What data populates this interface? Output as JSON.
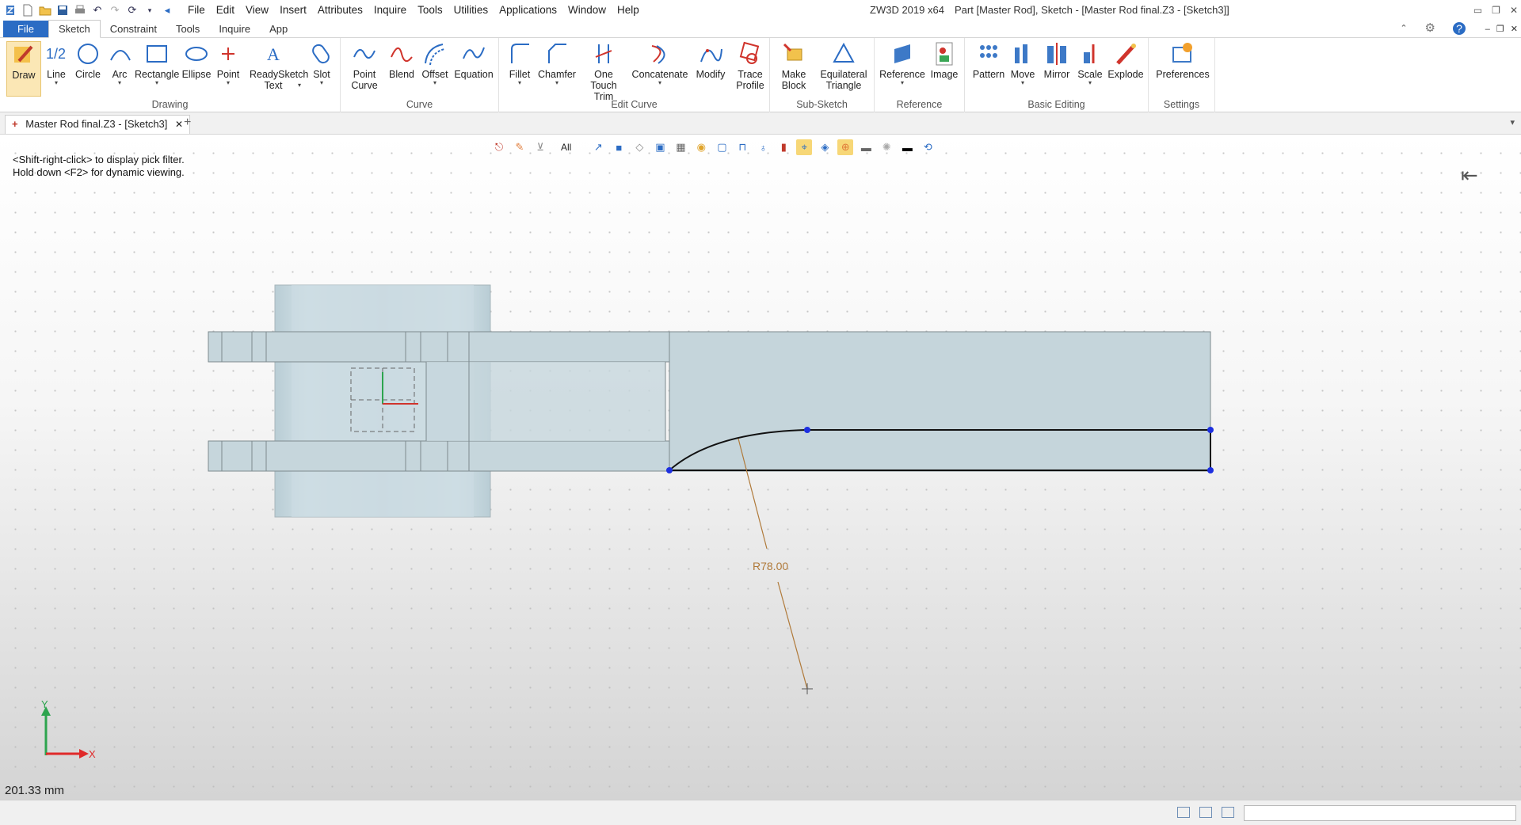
{
  "titlebar": {
    "menus": [
      "File",
      "Edit",
      "View",
      "Insert",
      "Attributes",
      "Inquire",
      "Tools",
      "Utilities",
      "Applications",
      "Window",
      "Help"
    ],
    "app_title": "ZW3D 2019  x64",
    "doc_title": "Part [Master Rod],  Sketch - [Master Rod final.Z3 - [Sketch3]]"
  },
  "ribbon_tabs": [
    "File",
    "Sketch",
    "Constraint",
    "Tools",
    "Inquire",
    "App"
  ],
  "ribbon": {
    "drawing": {
      "name": "Drawing",
      "buttons": [
        "Draw",
        "Line",
        "Circle",
        "Arc",
        "Rectangle",
        "Ellipse",
        "Point",
        "ReadySketch Text",
        "Slot"
      ]
    },
    "curve": {
      "name": "Curve",
      "buttons": [
        "Point Curve",
        "Blend",
        "Offset",
        "Equation"
      ]
    },
    "edit_curve": {
      "name": "Edit Curve",
      "buttons": [
        "Fillet",
        "Chamfer",
        "One Touch Trim",
        "Concatenate",
        "Modify",
        "Trace Profile"
      ]
    },
    "sub_sketch": {
      "name": "Sub-Sketch",
      "buttons": [
        "Make Block",
        "Equilateral Triangle"
      ]
    },
    "reference": {
      "name": "Reference",
      "buttons": [
        "Reference",
        "Image"
      ]
    },
    "basic_editing": {
      "name": "Basic Editing",
      "buttons": [
        "Pattern",
        "Move",
        "Mirror",
        "Scale",
        "Explode"
      ]
    },
    "settings": {
      "name": "Settings",
      "buttons": [
        "Preferences"
      ]
    }
  },
  "doc_tab": {
    "label": "Master Rod final.Z3 - [Sketch3]",
    "close": "✕",
    "add": "+"
  },
  "viewport": {
    "hint_line1": "<Shift-right-click> to display pick filter.",
    "hint_line2": "Hold down <F2> for dynamic viewing.",
    "filter": "All",
    "dimension_label": "R78.00",
    "axis_x": "X",
    "axis_y": "Y",
    "scale_readout": "201.33 mm"
  }
}
